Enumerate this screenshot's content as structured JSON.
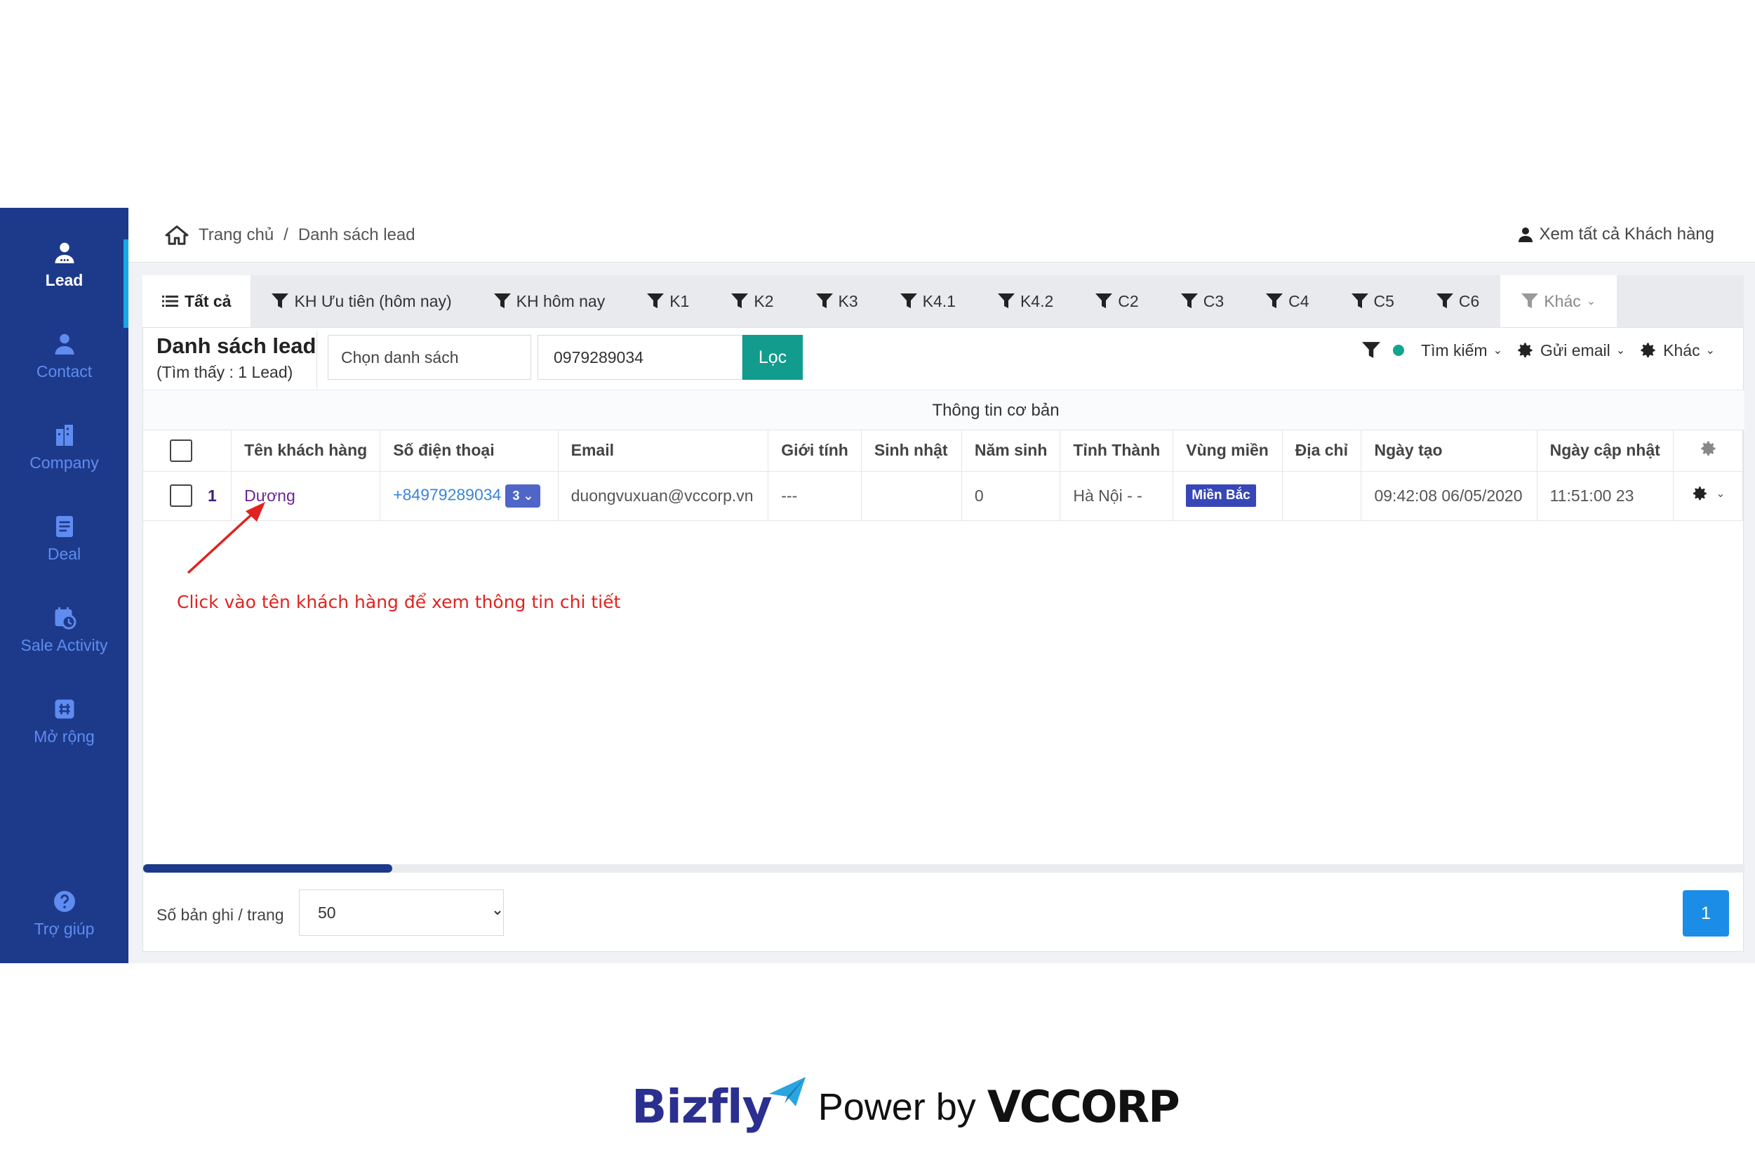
{
  "sidebar": {
    "items": [
      {
        "label": "Lead",
        "icon": "user-icon",
        "active": true
      },
      {
        "label": "Contact",
        "icon": "contact-icon"
      },
      {
        "label": "Company",
        "icon": "building-icon"
      },
      {
        "label": "Deal",
        "icon": "document-icon"
      },
      {
        "label": "Sale Activity",
        "icon": "calendar-clock-icon"
      },
      {
        "label": "Mở rộng",
        "icon": "hash-icon"
      }
    ],
    "help": {
      "label": "Trợ giúp",
      "icon": "question-icon"
    }
  },
  "header": {
    "breadcrumb": [
      "Trang chủ",
      "/",
      "Danh sách lead"
    ],
    "view_all": "Xem tất cả Khách hàng"
  },
  "tabs": [
    {
      "label": "Tất cả",
      "active": true
    },
    {
      "label": "KH Ưu tiên (hôm nay)"
    },
    {
      "label": "KH hôm nay"
    },
    {
      "label": "K1"
    },
    {
      "label": "K2"
    },
    {
      "label": "K3"
    },
    {
      "label": "K4.1"
    },
    {
      "label": "K4.2"
    },
    {
      "label": "C2"
    },
    {
      "label": "C3"
    },
    {
      "label": "C4"
    },
    {
      "label": "C5"
    },
    {
      "label": "C6"
    },
    {
      "label": "Khác"
    }
  ],
  "list": {
    "title": "Danh sách lead",
    "count_text": "(Tìm thấy : 1 Lead)",
    "choose_placeholder": "Chọn danh sách",
    "search_value": "0979289034",
    "filter_label": "Lọc"
  },
  "toolbar": {
    "search_label": "Tìm kiếm",
    "email_label": "Gửi email",
    "other_label": "Khác"
  },
  "table": {
    "group_header": "Thông tin cơ bản",
    "columns": [
      "Tên khách hàng",
      "Số điện thoại",
      "Email",
      "Giới tính",
      "Sinh nhật",
      "Năm sinh",
      "Tỉnh Thành",
      "Vùng miền",
      "Địa chỉ",
      "Ngày tạo",
      "Ngày cập nhật"
    ],
    "rows": [
      {
        "index": "1",
        "name": "Dương",
        "phone": "+84979289034",
        "phone_count": "3",
        "email": "duongvuxuan@vccorp.vn",
        "gender": "---",
        "birthday": "",
        "birth_year": "0",
        "province": "Hà Nội - -",
        "region": "Miền Bắc",
        "address": "",
        "created": "09:42:08 06/05/2020",
        "updated": "11:51:00 23"
      }
    ]
  },
  "annotation": "Click vào tên khách hàng để xem thông tin chi tiết",
  "pagination": {
    "per_page_label": "Số bản ghi / trang",
    "per_page_value": "50",
    "current_page": "1"
  },
  "brand": {
    "bizfly": "Bizfly",
    "power_by": "Power by",
    "vccorp": "VCCORP"
  },
  "colors": {
    "sidebar_bg": "#1d3a8a",
    "accent_teal": "#119c8d",
    "annotation_red": "#e0231e",
    "page_blue": "#1b8de6"
  }
}
